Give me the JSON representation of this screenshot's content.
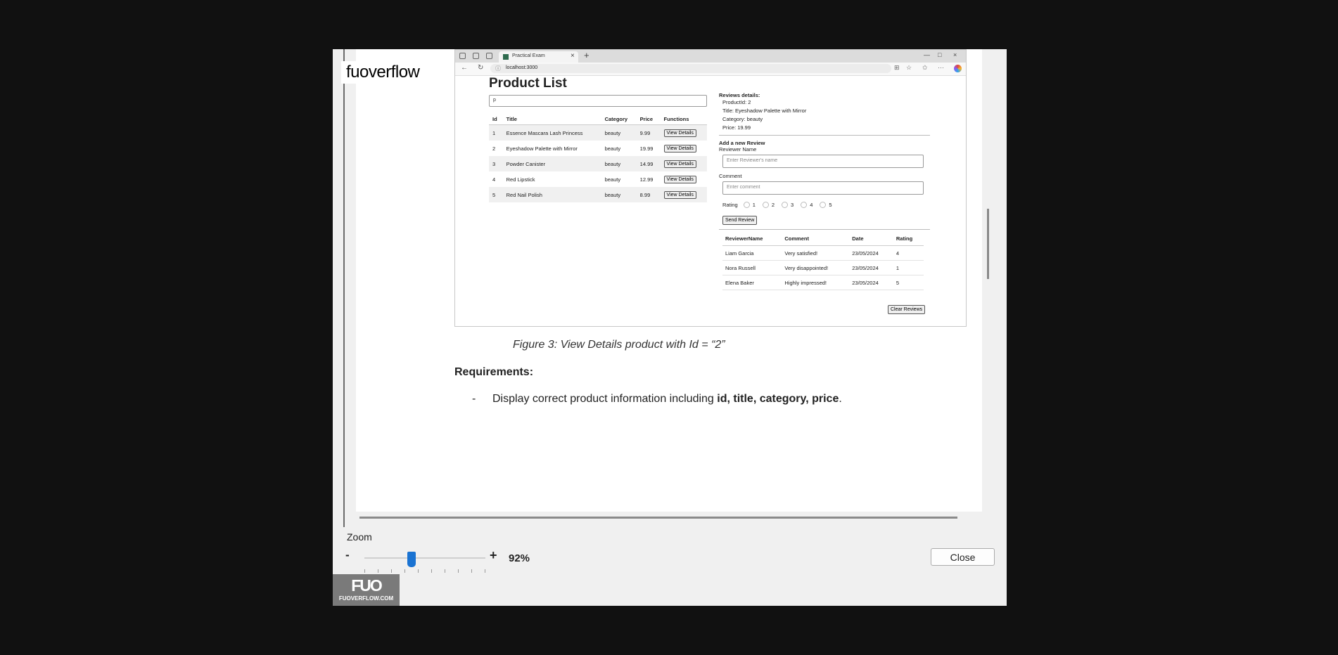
{
  "watermark": "fuoverflow",
  "browser": {
    "tab_title": "Practical Exam",
    "tab_close": "×",
    "new_tab": "+",
    "url": "localhost:3000",
    "win_minimize": "—",
    "win_maximize": "□",
    "win_close": "×"
  },
  "product_list": {
    "title": "Product List",
    "search_value": "p",
    "columns": [
      "Id",
      "Title",
      "Category",
      "Price",
      "Functions"
    ],
    "rows": [
      {
        "id": "1",
        "title": "Essence Mascara Lash Princess",
        "category": "beauty",
        "price": "9.99",
        "action": "View Details"
      },
      {
        "id": "2",
        "title": "Eyeshadow Palette with Mirror",
        "category": "beauty",
        "price": "19.99",
        "action": "View Details"
      },
      {
        "id": "3",
        "title": "Powder Canister",
        "category": "beauty",
        "price": "14.99",
        "action": "View Details"
      },
      {
        "id": "4",
        "title": "Red Lipstick",
        "category": "beauty",
        "price": "12.99",
        "action": "View Details"
      },
      {
        "id": "5",
        "title": "Red Nail Polish",
        "category": "beauty",
        "price": "8.99",
        "action": "View Details"
      }
    ]
  },
  "reviews": {
    "heading": "Reviews details:",
    "product_id": "ProductId: 2",
    "product_title": "Title: Eyeshadow Palette with Mirror",
    "category": "Category: beauty",
    "price": "Price: 19.99",
    "add_heading": "Add a new Review",
    "name_label": "Reviewer Name",
    "name_placeholder": "Enter Reviewer's name",
    "comment_label": "Comment",
    "comment_placeholder": "Enter comment",
    "rating_label": "Rating",
    "rating_options": [
      "1",
      "2",
      "3",
      "4",
      "5"
    ],
    "send_button": "Send Review",
    "columns": [
      "ReviewerName",
      "Comment",
      "Date",
      "Rating"
    ],
    "rows": [
      {
        "name": "Liam Garcia",
        "comment": "Very satisfied!",
        "date": "23/05/2024",
        "rating": "4"
      },
      {
        "name": "Nora Russell",
        "comment": "Very disappointed!",
        "date": "23/05/2024",
        "rating": "1"
      },
      {
        "name": "Elena Baker",
        "comment": "Highly impressed!",
        "date": "23/05/2024",
        "rating": "5"
      }
    ],
    "clear_button": "Clear Reviews"
  },
  "document": {
    "caption": "Figure 3: View Details product with Id = “2”",
    "requirements_heading": "Requirements:",
    "bullet": "-",
    "req_text": "Display correct product information including ",
    "req_bold": "id, title, category, price",
    "req_end": "."
  },
  "zoom": {
    "label": "Zoom",
    "minus": "-",
    "plus": "+",
    "value": "92%",
    "level_fraction": 0.39
  },
  "close_button": "Close",
  "logo": {
    "mark": "FUO",
    "text": "FUOVERFLOW.COM"
  }
}
